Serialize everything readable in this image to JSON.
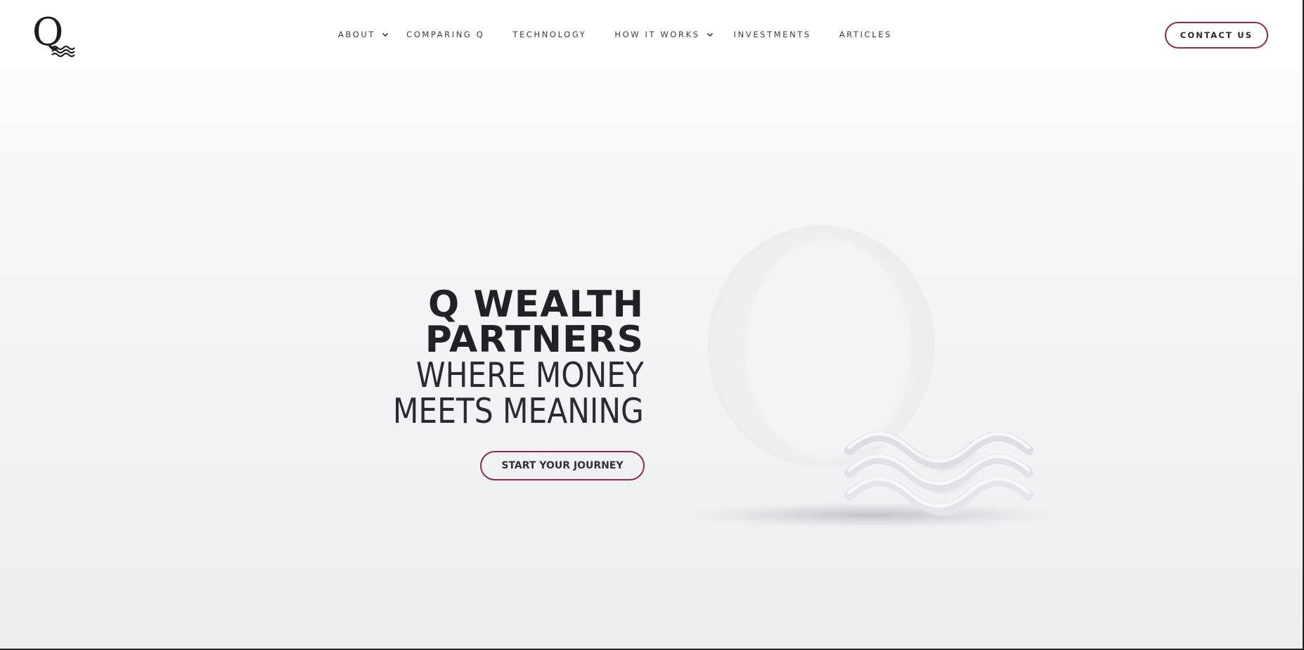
{
  "brand": {
    "logo_icon": "q-waves-logo",
    "accent_color": "#8e2a4e"
  },
  "nav": {
    "items": [
      {
        "label": "ABOUT",
        "has_dropdown": true
      },
      {
        "label": "COMPARING Q",
        "has_dropdown": false
      },
      {
        "label": "TECHNOLOGY",
        "has_dropdown": false
      },
      {
        "label": "HOW IT WORKS",
        "has_dropdown": true
      },
      {
        "label": "INVESTMENTS",
        "has_dropdown": false
      },
      {
        "label": "ARTICLES",
        "has_dropdown": false
      }
    ]
  },
  "header": {
    "contact_label": "CONTACT US"
  },
  "hero": {
    "title_line1": "Q WEALTH",
    "title_line2": "PARTNERS",
    "subtitle_line1": "WHERE MONEY",
    "subtitle_line2": "MEETS MEANING",
    "cta_label": "START YOUR JOURNEY",
    "art_icon": "q-waves-emblem"
  }
}
